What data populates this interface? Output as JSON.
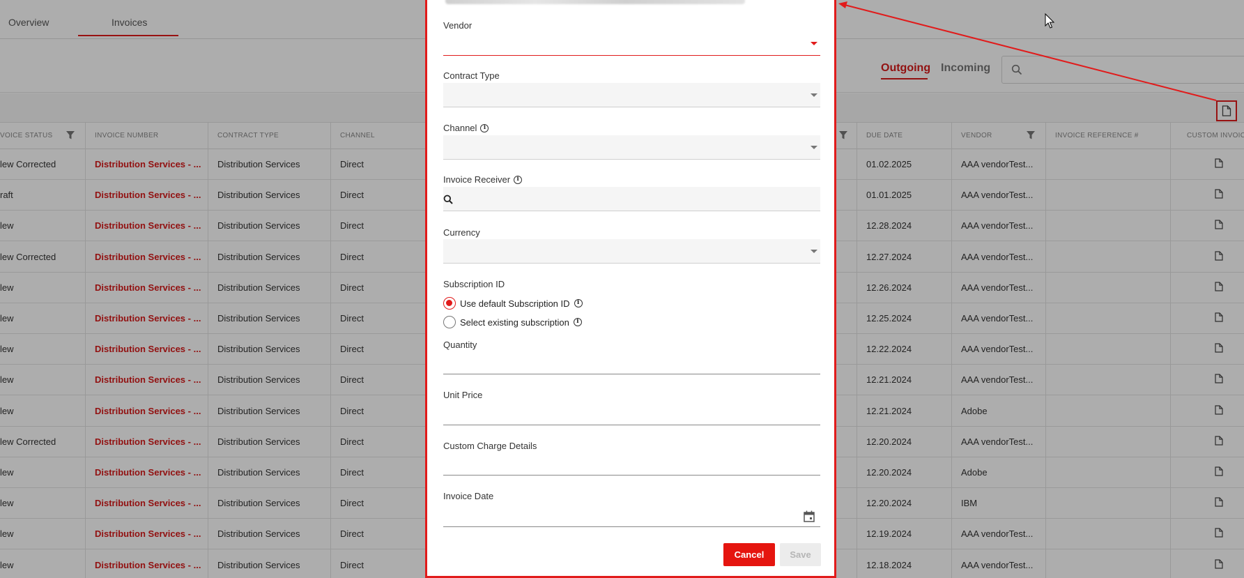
{
  "tabs": [
    {
      "label": "Overview"
    },
    {
      "label": "Invoices",
      "active": true
    }
  ],
  "direction": {
    "outgoing": "Outgoing",
    "incoming": "Incoming",
    "active": "Outgoing"
  },
  "search": {
    "placeholder": ""
  },
  "columns": {
    "invoice_status": "VOICE STATUS",
    "invoice_number": "INVOICE NUMBER",
    "contract_type": "CONTRACT TYPE",
    "channel": "CHANNEL",
    "due_date": "DUE DATE",
    "vendor": "VENDOR",
    "invoice_reference": "INVOICE REFERENCE #",
    "custom_invoice": "CUSTOM INVOIC"
  },
  "rows": [
    {
      "status": "lew Corrected",
      "number": "Distribution Services - ...",
      "contract": "Distribution Services",
      "channel": "Direct",
      "due": "01.02.2025",
      "vendor": "AAA vendorTest..."
    },
    {
      "status": "raft",
      "number": "Distribution Services - ...",
      "contract": "Distribution Services",
      "channel": "Direct",
      "due": "01.01.2025",
      "vendor": "AAA vendorTest..."
    },
    {
      "status": "lew",
      "number": "Distribution Services - ...",
      "contract": "Distribution Services",
      "channel": "Direct",
      "due": "12.28.2024",
      "vendor": "AAA vendorTest..."
    },
    {
      "status": "lew Corrected",
      "number": "Distribution Services - ...",
      "contract": "Distribution Services",
      "channel": "Direct",
      "due": "12.27.2024",
      "vendor": "AAA vendorTest..."
    },
    {
      "status": "lew",
      "number": "Distribution Services - ...",
      "contract": "Distribution Services",
      "channel": "Direct",
      "due": "12.26.2024",
      "vendor": "AAA vendorTest..."
    },
    {
      "status": "lew",
      "number": "Distribution Services - ...",
      "contract": "Distribution Services",
      "channel": "Direct",
      "due": "12.25.2024",
      "vendor": "AAA vendorTest..."
    },
    {
      "status": "lew",
      "number": "Distribution Services - ...",
      "contract": "Distribution Services",
      "channel": "Direct",
      "due": "12.22.2024",
      "vendor": "AAA vendorTest..."
    },
    {
      "status": "lew",
      "number": "Distribution Services - ...",
      "contract": "Distribution Services",
      "channel": "Direct",
      "due": "12.21.2024",
      "vendor": "AAA vendorTest..."
    },
    {
      "status": "lew",
      "number": "Distribution Services - ...",
      "contract": "Distribution Services",
      "channel": "Direct",
      "due": "12.21.2024",
      "vendor": "Adobe"
    },
    {
      "status": "lew Corrected",
      "number": "Distribution Services - ...",
      "contract": "Distribution Services",
      "channel": "Direct",
      "due": "12.20.2024",
      "vendor": "AAA vendorTest..."
    },
    {
      "status": "lew",
      "number": "Distribution Services - ...",
      "contract": "Distribution Services",
      "channel": "Direct",
      "due": "12.20.2024",
      "vendor": "Adobe"
    },
    {
      "status": "lew",
      "number": "Distribution Services - ...",
      "contract": "Distribution Services",
      "channel": "Direct",
      "due": "12.20.2024",
      "vendor": "IBM"
    },
    {
      "status": "lew",
      "number": "Distribution Services - ...",
      "contract": "Distribution Services",
      "channel": "Direct",
      "due": "12.19.2024",
      "vendor": "AAA vendorTest..."
    },
    {
      "status": "lew",
      "number": "Distribution Services - ...",
      "contract": "Distribution Services",
      "channel": "Direct",
      "due": "12.18.2024",
      "vendor": "AAA vendorTest..."
    }
  ],
  "modal": {
    "vendor_label": "Vendor",
    "vendor_value": "",
    "contract_type_label": "Contract Type",
    "channel_label": "Channel",
    "invoice_receiver_label": "Invoice Receiver",
    "currency_label": "Currency",
    "subscription_id_label": "Subscription ID",
    "radio_default": "Use default Subscription ID",
    "radio_existing": "Select existing subscription",
    "radio_selected": "Use default Subscription ID",
    "quantity_label": "Quantity",
    "unit_price_label": "Unit Price",
    "custom_charge_label": "Custom Charge Details",
    "invoice_date_label": "Invoice Date",
    "cancel_label": "Cancel",
    "save_label": "Save"
  },
  "colors": {
    "accent": "#e11b1b",
    "link": "#d71a1a",
    "overlay": "rgba(0,0,0,0.32)"
  },
  "icons": [
    "search-icon",
    "filter-icon",
    "file-icon",
    "info-icon",
    "calendar-icon",
    "caret-down-icon",
    "cursor-icon"
  ]
}
